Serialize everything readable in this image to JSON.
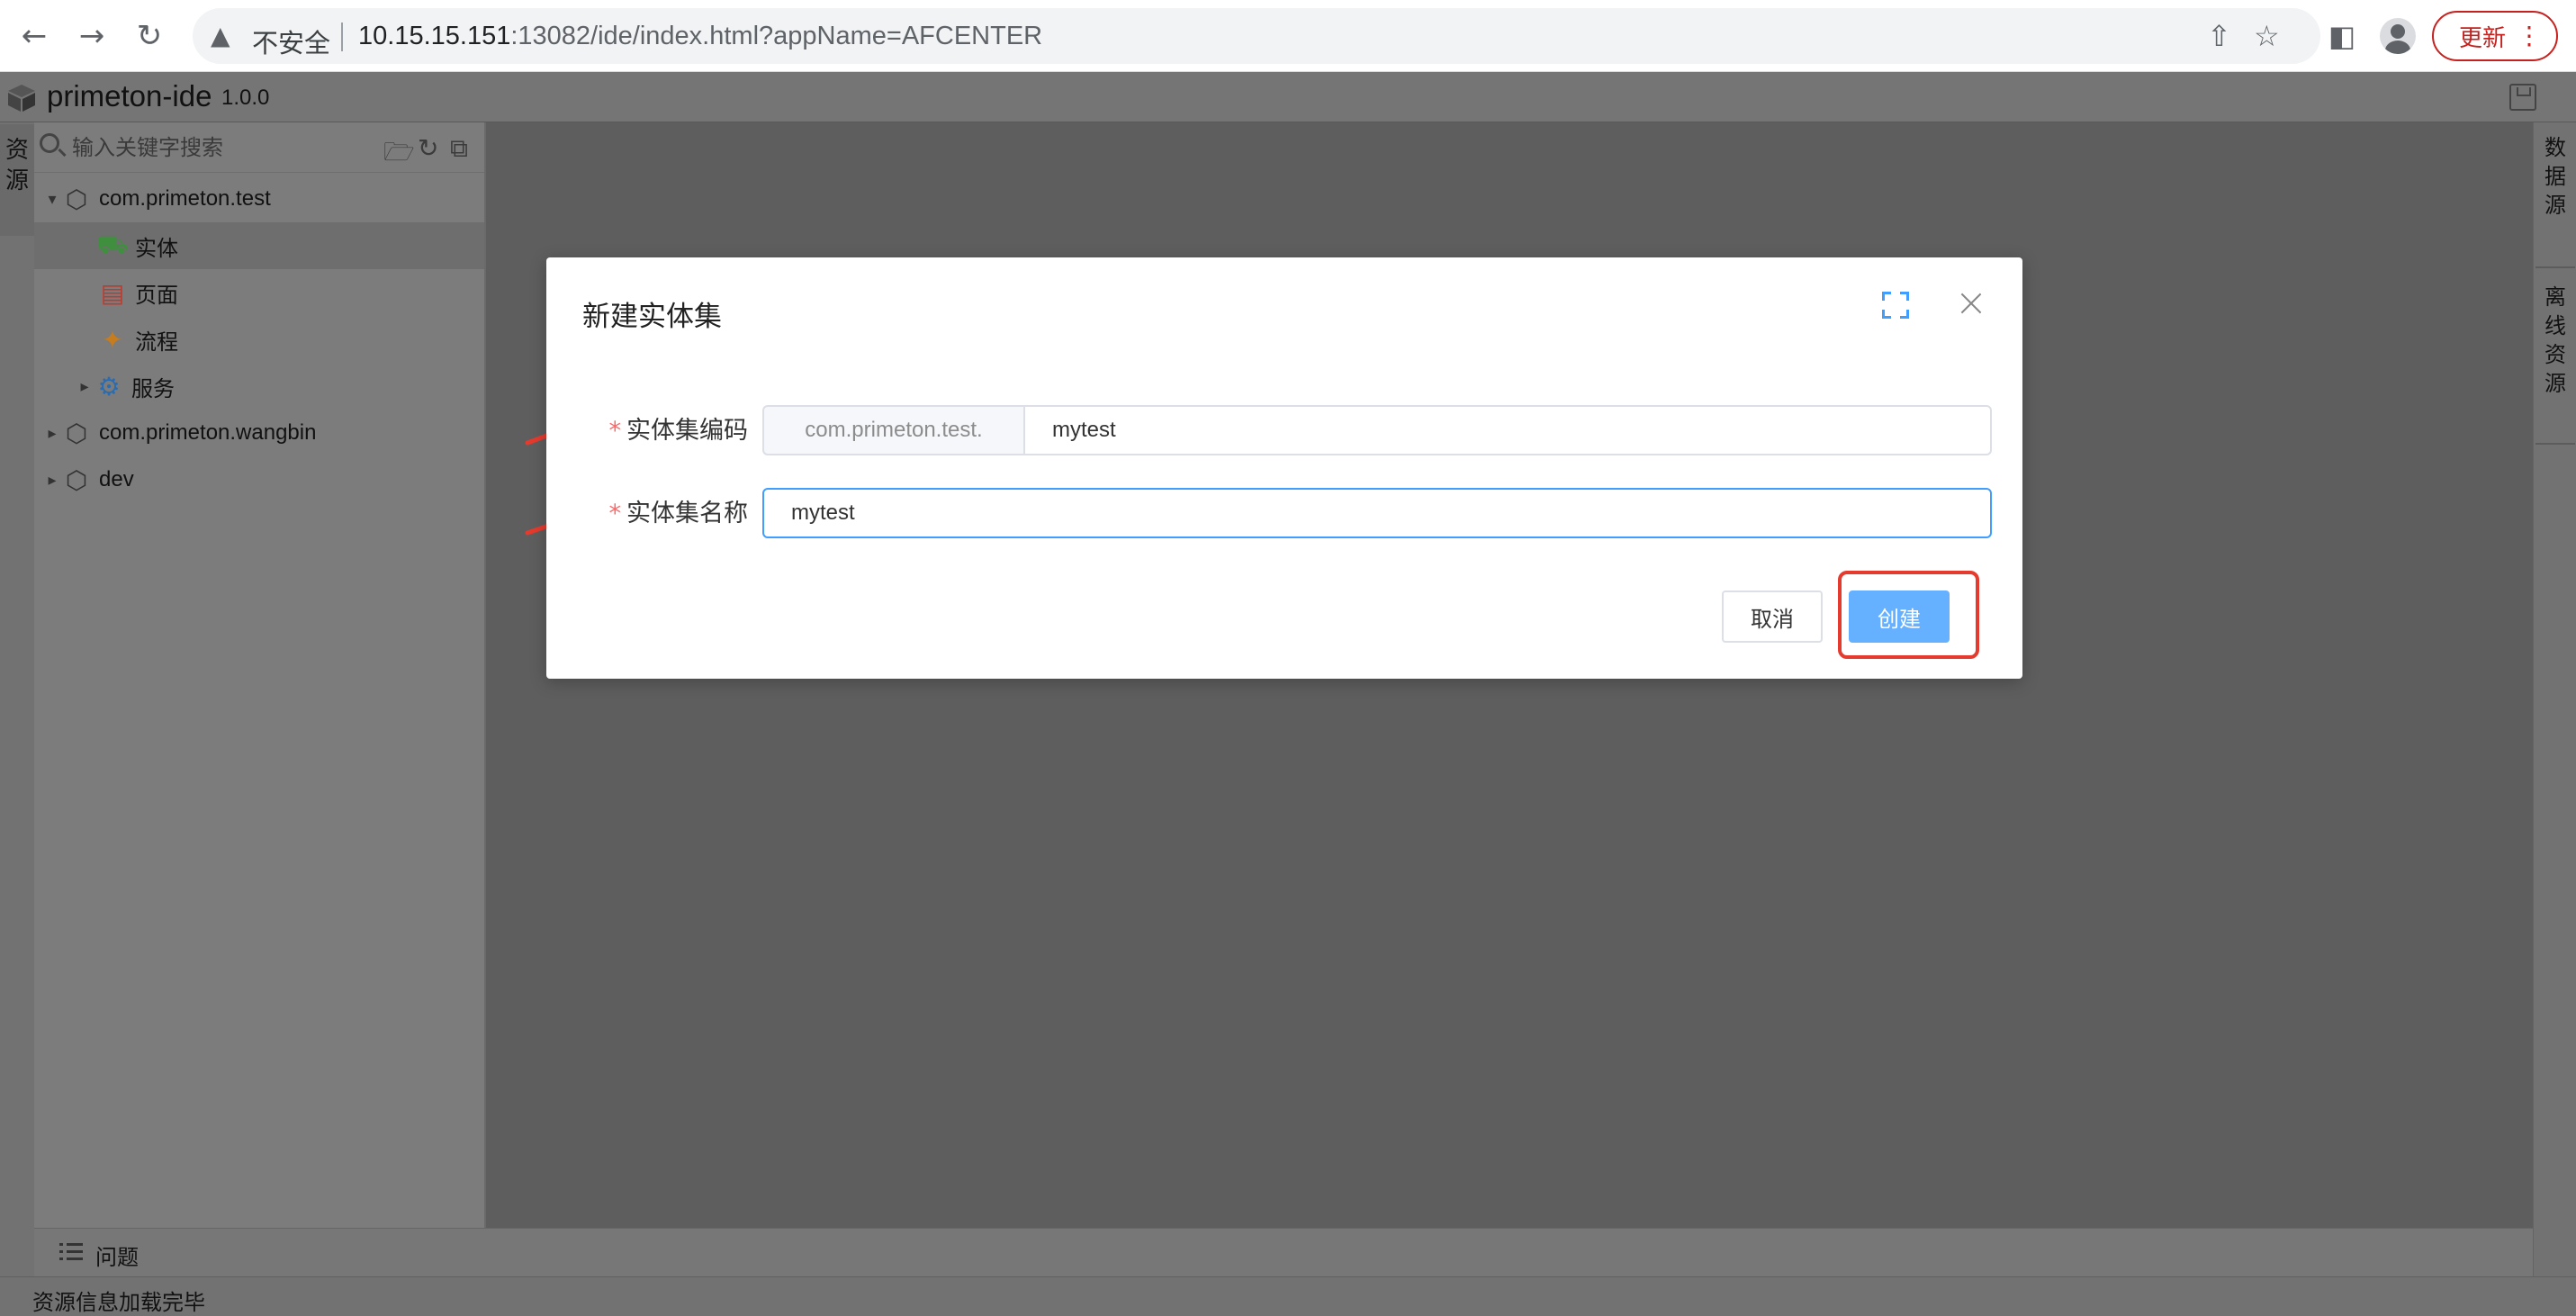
{
  "browser": {
    "security_label": "不安全",
    "url_host": "10.15.15.151",
    "url_rest": ":13082/ide/index.html?appName=AFCENTER",
    "update_label": "更新"
  },
  "ide": {
    "title": "primeton-ide",
    "version": "1.0.0"
  },
  "left_rail": {
    "tab_label": "资源"
  },
  "explorer": {
    "search_placeholder": "输入关键字搜索",
    "tree": [
      {
        "label": "com.primeton.test",
        "expanded": true,
        "icon": "package-icon"
      },
      {
        "label": "实体",
        "icon": "database-icon",
        "selected": true
      },
      {
        "label": "页面",
        "icon": "page-icon"
      },
      {
        "label": "流程",
        "icon": "flow-icon"
      },
      {
        "label": "服务",
        "icon": "gear-icon",
        "expanded": false
      },
      {
        "label": "com.primeton.wangbin",
        "expanded": false,
        "icon": "package-icon"
      },
      {
        "label": "dev",
        "expanded": false,
        "icon": "package-icon"
      }
    ]
  },
  "right_rail": {
    "tabs": [
      "数据源",
      "离线资源"
    ]
  },
  "problems": {
    "label": "问题"
  },
  "status": {
    "message": "资源信息加载完毕"
  },
  "dialog": {
    "title": "新建实体集",
    "code_label": "实体集编码",
    "code_prefix": "com.primeton.test.",
    "code_value": "mytest",
    "name_label": "实体集名称",
    "name_value": "mytest",
    "required_mark": "*",
    "cancel_label": "取消",
    "create_label": "创建"
  },
  "colors": {
    "primary": "#409eff",
    "primary_light": "#66b1ff",
    "annotation_red": "#e53a2e",
    "required_red": "#f56c6c"
  }
}
